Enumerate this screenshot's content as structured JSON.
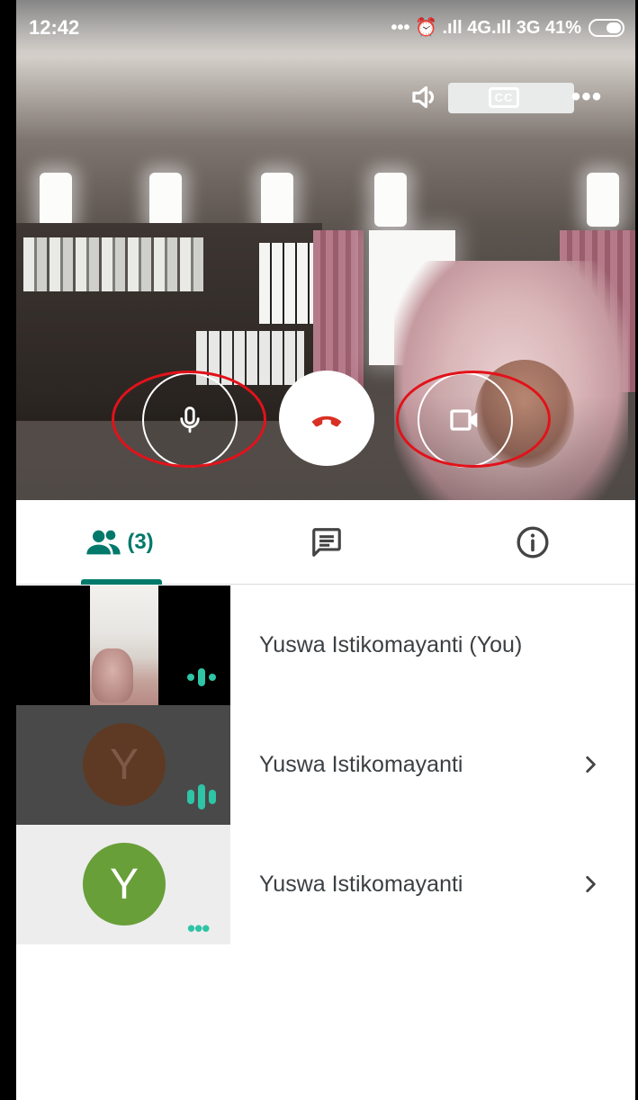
{
  "status_bar": {
    "time": "12:42",
    "indicators": "••• ⏰ .ıll 4G.ıll 3G 41%"
  },
  "call_controls": {
    "speaker_icon": "speaker-icon",
    "captions_label": "CC",
    "more_icon": "more-horizontal-icon",
    "mic_icon": "microphone-icon",
    "hangup_icon": "phone-hangup-icon",
    "camera_icon": "video-camera-icon",
    "hangup_color": "#d93025",
    "highlight_ring_color": "#e2121a"
  },
  "tabs": [
    {
      "id": "people",
      "icon": "people-icon",
      "count": "(3)",
      "active": true
    },
    {
      "id": "chat",
      "icon": "chat-icon",
      "active": false
    },
    {
      "id": "info",
      "icon": "info-icon",
      "active": false
    }
  ],
  "participants": [
    {
      "name": "Yuswa Istikomayanti (You)",
      "avatar_letter": "",
      "has_chevron": false,
      "audio": "speaking-low"
    },
    {
      "name": "Yuswa Istikomayanti",
      "avatar_letter": "Y",
      "avatar_color": "#5e3a24",
      "has_chevron": true,
      "audio": "speaking-high"
    },
    {
      "name": "Yuswa Istikomayanti",
      "avatar_letter": "Y",
      "avatar_color": "#689f38",
      "has_chevron": true,
      "audio": "idle"
    }
  ],
  "accent_color": "#00796b"
}
